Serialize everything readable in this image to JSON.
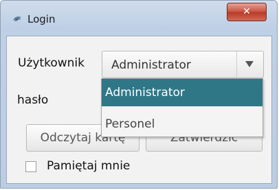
{
  "window": {
    "title": "Login",
    "close_glyph": "✕",
    "app_icon": "app-icon"
  },
  "form": {
    "user_label": "Użytkownik",
    "password_label": "hasło",
    "user_select": {
      "selected": "Administrator",
      "options": [
        "Administrator",
        "Personel"
      ],
      "highlighted_option": "Administrator"
    },
    "read_card_button": "Odczytaj kartę",
    "confirm_button": "Zatwierdzić",
    "remember_label": "Pamiętaj mnie",
    "remember_checked": false
  },
  "colors": {
    "selection_highlight": "#2f7787",
    "close_button": "#c9503d"
  }
}
